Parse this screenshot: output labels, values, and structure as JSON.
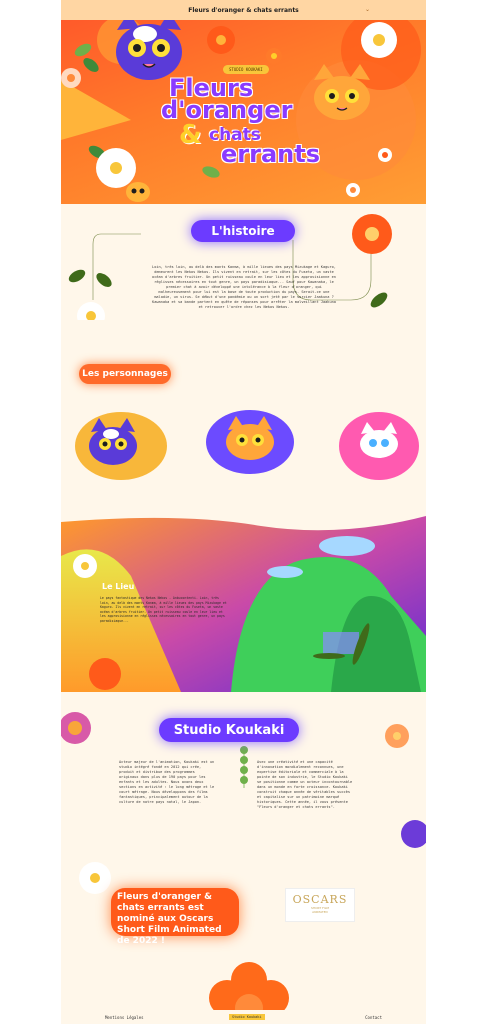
{
  "header": {
    "title": "Fleurs d'oranger & chats errants",
    "chevron": "⌄"
  },
  "hero": {
    "studio_tag": "STUDIO KOUKAKI",
    "title_line1": "Fleurs",
    "title_line2": "d'oranger",
    "ampersand": "&",
    "title_line3": "chats",
    "title_line4": "errants"
  },
  "histoire": {
    "heading": "L'histoire",
    "text": "Loin, très loin, au delà des monts Kanma, à mille lieues des pays Mizukage et Kaguro, demeurent les Nekos Nekos. Ils vivent en retrait, sur les côtes du Fuseta, un vaste océan d'arbres fruitier. Un petit ruisseau coule en leur lieu et les approvisionne en réglisses nécessaires en tout genre, un pays paradisiaque... Sauf pour Kawanaka, le premier chat à avoir développé une intolérance à la fleur d'oranger, qui malheureusement pour lui est la base de toute production du pays. Serait-ce une maladie, un virus. Se début d'une pandémie ou un sort jeté par le sorcier Jaakuna ? Kawanaka et sa bande partent en quête de réponses pour arrêter la malveillant Jaakuna et retrouver l'ordre chez les Nekos Nekos."
  },
  "personnages": {
    "heading": "Les personnages"
  },
  "lieu": {
    "heading": "Le Lieu",
    "text": "Le pays fantastique des Nekos Nekos - Anbucontenti. Loin, très loin, au delà des monts Kanma, à mille lieues des pays Mizukage et Kaguro. Ils vivent en retrait, sur les côtes du Fuseta, un vaste océan d'arbres fruitier. Un petit ruisseau coule en leur lieu et les approvisionne en réglisses nécessaires en tout genre, un pays paradisiaque..."
  },
  "studio": {
    "heading": "Studio Koukaki",
    "text_left": "Acteur majeur de l'animation, Koukaki est un studio intégré fondé en 2012 qui crée, produit et distribue des programmes originaux dans plus de 190 pays pour les enfants et les adultes. Nous avons deux sections en activité : le long métrage et le court métrage. Nous développons des films fantastiques, principalement autour de la culture de notre pays natal, le Japon.",
    "text_right": "Avec une créativité et une capacité d'innovation mondialement reconnues, une expertise éditoriale et commerciale à la pointe de son industrie, le Studio Koukaki se positionne comme un acteur incontournable dans un monde en forte croissance. Koukaki construit chaque année de véritables succès et capitalise sur un patrimoine marqué historiques. Cette année, il vous présente \"Fleurs d'oranger et chats errants\"."
  },
  "oscars": {
    "text": "Fleurs d'oranger & chats errants est nominé aux Oscars Short Film Animated de 2022 !",
    "logo": "OSCARS",
    "logo_sub1": "SHORT FILM",
    "logo_sub2": "ANIMATED"
  },
  "footer": {
    "left": "Mentions Légales",
    "middle": "Studio Koukaki",
    "right": "Contact"
  },
  "colors": {
    "orange": "#ff6a2a",
    "violet": "#6c3bff",
    "yellow": "#f8c63a",
    "cream": "#fff7ea"
  }
}
